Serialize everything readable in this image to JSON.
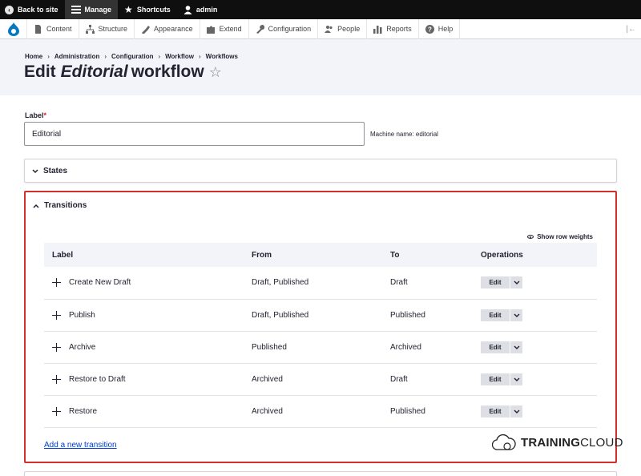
{
  "toolbar": {
    "back": "Back to site",
    "manage": "Manage",
    "shortcuts": "Shortcuts",
    "user": "admin"
  },
  "tray": {
    "items": [
      "Content",
      "Structure",
      "Appearance",
      "Extend",
      "Configuration",
      "People",
      "Reports",
      "Help"
    ]
  },
  "breadcrumb": [
    "Home",
    "Administration",
    "Configuration",
    "Workflow",
    "Workflows"
  ],
  "breadcrumb_sep": "›",
  "title": {
    "prefix": "Edit",
    "name": "Editorial",
    "suffix": "workflow"
  },
  "form": {
    "label_title": "Label",
    "label_required": "*",
    "label_value": "Editorial",
    "machine_name": "Machine name: editorial"
  },
  "states": {
    "summary": "States"
  },
  "transitions": {
    "summary": "Transitions",
    "show_row_weights": "Show row weights",
    "headers": [
      "Label",
      "From",
      "To",
      "Operations"
    ],
    "rows": [
      {
        "label": "Create New Draft",
        "from": "Draft, Published",
        "to": "Draft",
        "op": "Edit"
      },
      {
        "label": "Publish",
        "from": "Draft, Published",
        "to": "Published",
        "op": "Edit"
      },
      {
        "label": "Archive",
        "from": "Published",
        "to": "Archived",
        "op": "Edit"
      },
      {
        "label": "Restore to Draft",
        "from": "Archived",
        "to": "Draft",
        "op": "Edit"
      },
      {
        "label": "Restore",
        "from": "Archived",
        "to": "Published",
        "op": "Edit"
      }
    ],
    "add_link": "Add a new transition"
  },
  "watermark": {
    "bold": "TRAINING",
    "light": "CLOUD"
  },
  "colors": {
    "toolbar": "#0f0f0f",
    "link": "#003ecc",
    "highlight": "#d62e2e",
    "drupal_blue": "#0678be"
  }
}
